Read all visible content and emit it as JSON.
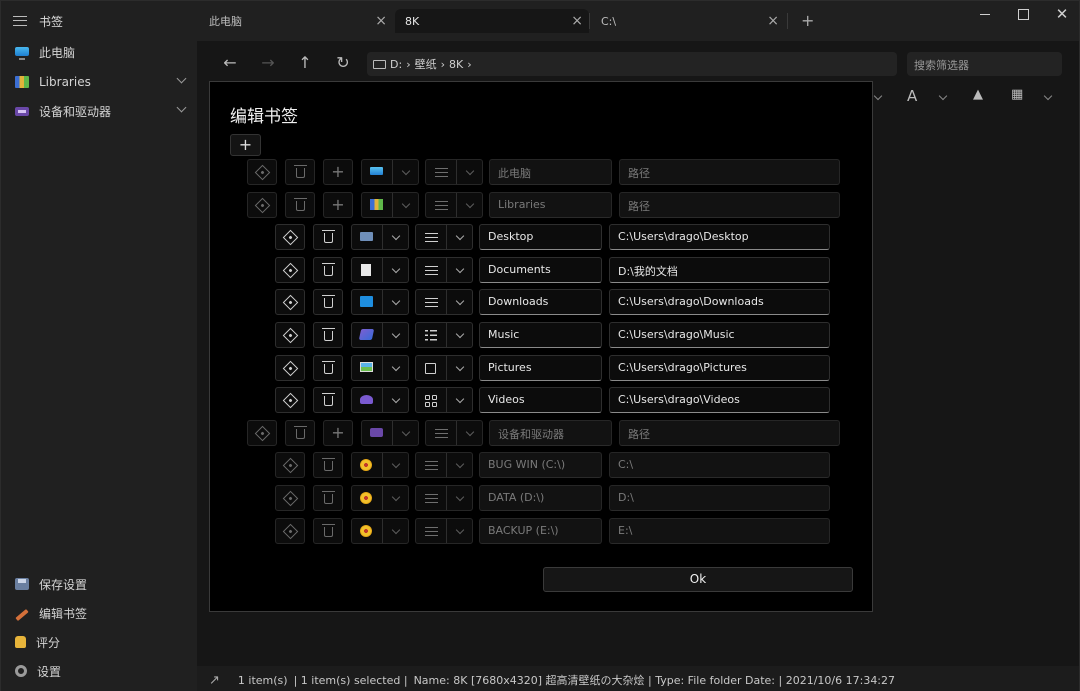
{
  "sidebar": {
    "title": "书签",
    "items": [
      {
        "label": "此电脑",
        "icon": "pc-icon"
      },
      {
        "label": "Libraries",
        "icon": "libraries-icon"
      },
      {
        "label": "设备和驱动器",
        "icon": "devices-icon"
      }
    ],
    "bottom": [
      {
        "label": "保存设置",
        "icon": "save-icon"
      },
      {
        "label": "编辑书签",
        "icon": "pencil-icon"
      },
      {
        "label": "评分",
        "icon": "thumbs-up-icon"
      },
      {
        "label": "设置",
        "icon": "gear-icon"
      }
    ]
  },
  "tabs": [
    {
      "label": "此电脑"
    },
    {
      "label": "8K"
    },
    {
      "label": "C:\\"
    }
  ],
  "navbar": {
    "crumbs": [
      "D:",
      "壁纸",
      "8K"
    ],
    "search_placeholder": "搜索筛选器"
  },
  "dialog": {
    "title": "编辑书签",
    "add_label": "+",
    "ok_label": "Ok",
    "rows": [
      {
        "name": "此电脑",
        "path": "路径",
        "icon": "pc",
        "view": "lines",
        "level": 0,
        "dim": true
      },
      {
        "name": "Libraries",
        "path": "路径",
        "icon": "lib",
        "view": "lines",
        "level": 0,
        "dim": true
      },
      {
        "name": "Desktop",
        "path": "C:\\Users\\drago\\Desktop",
        "icon": "desk",
        "view": "lines",
        "level": 1,
        "dim": false
      },
      {
        "name": "Documents",
        "path": "D:\\我的文档",
        "icon": "doc",
        "view": "lines",
        "level": 1,
        "dim": false
      },
      {
        "name": "Downloads",
        "path": "C:\\Users\\drago\\Downloads",
        "icon": "dl",
        "view": "lines",
        "level": 1,
        "dim": false
      },
      {
        "name": "Music",
        "path": "C:\\Users\\drago\\Music",
        "icon": "music",
        "view": "list",
        "level": 1,
        "dim": false
      },
      {
        "name": "Pictures",
        "path": "C:\\Users\\drago\\Pictures",
        "icon": "pic",
        "view": "square",
        "level": 1,
        "dim": false
      },
      {
        "name": "Videos",
        "path": "C:\\Users\\drago\\Videos",
        "icon": "vid",
        "view": "grid",
        "level": 1,
        "dim": false
      },
      {
        "name": "设备和驱动器",
        "path": "路径",
        "icon": "dev",
        "view": "lines",
        "level": 0,
        "dim": true
      },
      {
        "name": "BUG WIN (C:\\)",
        "path": "C:\\",
        "icon": "disk",
        "view": "lines",
        "level": 1,
        "dim": true
      },
      {
        "name": "DATA (D:\\)",
        "path": "D:\\",
        "icon": "disk",
        "view": "lines",
        "level": 1,
        "dim": true
      },
      {
        "name": "BACKUP (E:\\)",
        "path": "E:\\",
        "icon": "disk",
        "view": "lines",
        "level": 1,
        "dim": true
      }
    ]
  },
  "status": {
    "items": "1 item(s)",
    "selected": "| 1 item(s) selected |",
    "details": "Name: 8K [7680x4320]  超高清壁纸の大杂烩 | Type: File folder Date: | 2021/10/6 17:34:27"
  }
}
